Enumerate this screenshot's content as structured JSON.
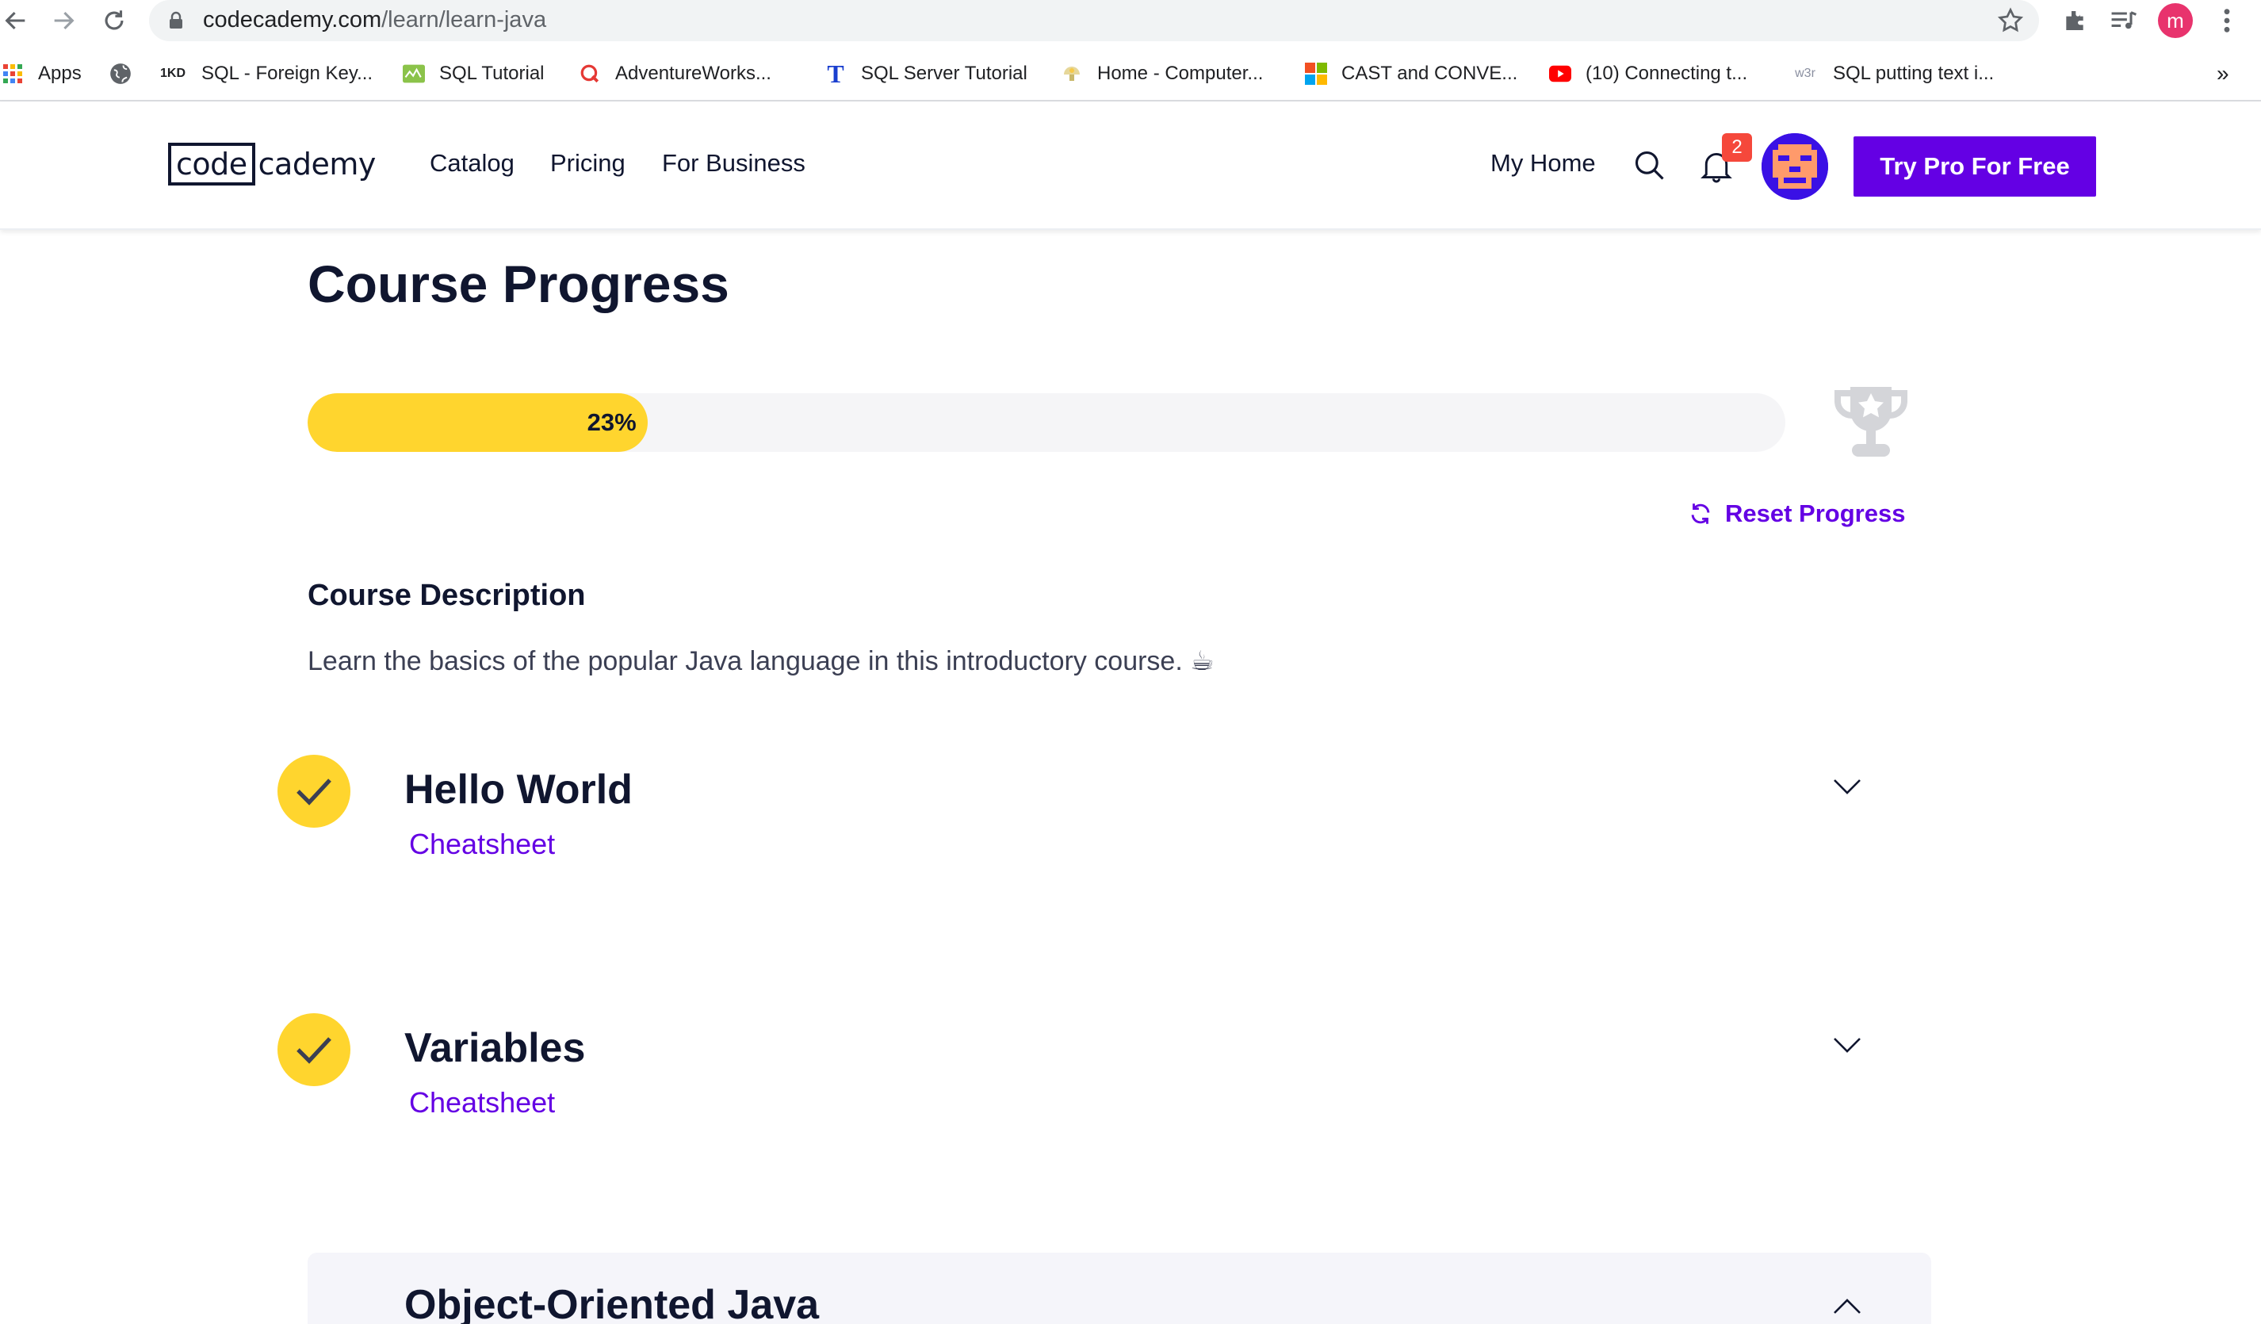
{
  "browser": {
    "url_host": "codecademy.com",
    "url_path": "/learn/learn-java",
    "profile_initial": "m",
    "bookmarks": [
      {
        "label": "Apps",
        "icon": "apps-grid-icon"
      },
      {
        "label": "",
        "icon": "globe-icon"
      },
      {
        "label": "SQL - Foreign Key...",
        "icon_text": "1KD"
      },
      {
        "label": "SQL Tutorial",
        "icon": "sqltutorial-icon"
      },
      {
        "label": "AdventureWorks...",
        "icon": "red-q-icon"
      },
      {
        "label": "SQL Server Tutorial",
        "icon_text": "T"
      },
      {
        "label": "Home - Computer...",
        "icon": "lamp-icon"
      },
      {
        "label": "CAST and CONVE...",
        "icon": "microsoft-icon"
      },
      {
        "label": "(10) Connecting t...",
        "icon": "youtube-icon"
      },
      {
        "label": "SQL putting text i...",
        "icon_text": "w3r"
      }
    ],
    "more_bookmarks": "»"
  },
  "header": {
    "logo_boxed": "code",
    "logo_rest": "cademy",
    "nav": [
      "Catalog",
      "Pricing",
      "For Business"
    ],
    "my_home": "My Home",
    "notification_count": "2",
    "cta": "Try Pro For Free"
  },
  "main": {
    "title": "Course Progress",
    "progress_percent": 23,
    "progress_label": "23%",
    "reset_label": "Reset Progress",
    "description_title": "Course Description",
    "description_text": "Learn the basics of the popular Java language in this introductory course. ☕",
    "modules": [
      {
        "title": "Hello World",
        "link": "Cheatsheet",
        "completed": true,
        "expanded": false
      },
      {
        "title": "Variables",
        "link": "Cheatsheet",
        "completed": true,
        "expanded": false
      },
      {
        "title": "Object-Oriented Java",
        "completed": false,
        "expanded": true
      }
    ]
  },
  "colors": {
    "brand_purple": "#6400e4",
    "progress_yellow": "#ffd52e",
    "text_dark": "#10162f",
    "badge_red": "#f5483b"
  }
}
